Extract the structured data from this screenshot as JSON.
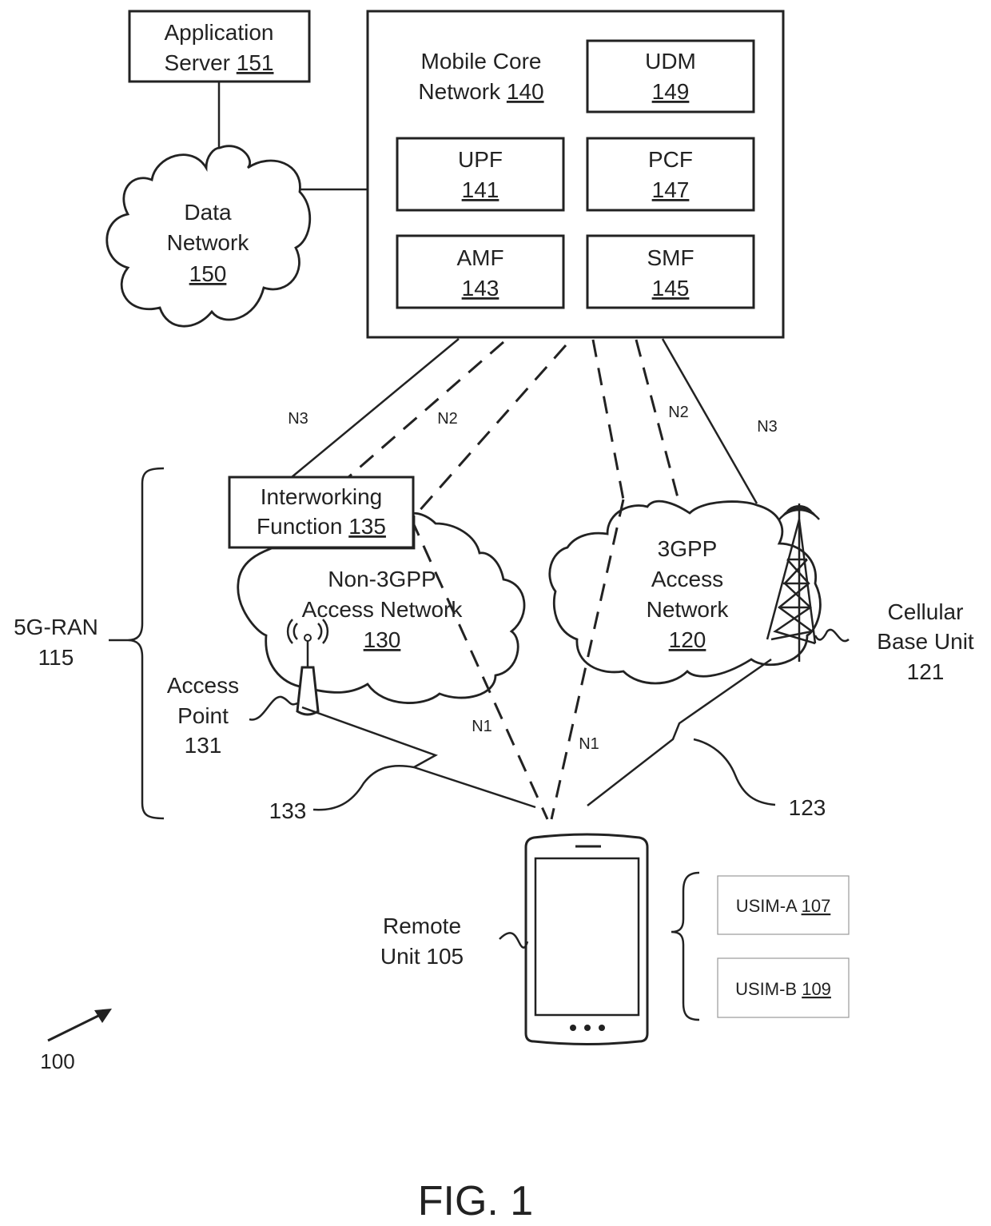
{
  "figure": {
    "title": "FIG. 1",
    "ref": "100"
  },
  "app_server": {
    "line1": "Application",
    "line2": "Server ",
    "num": "151"
  },
  "data_network": {
    "line1": "Data",
    "line2": "Network",
    "num": "150"
  },
  "core": {
    "line1": "Mobile Core",
    "line2": "Network ",
    "num": "140",
    "functions": [
      {
        "name": "UDM",
        "num": "149"
      },
      {
        "name": "UPF",
        "num": "141"
      },
      {
        "name": "PCF",
        "num": "147"
      },
      {
        "name": "AMF",
        "num": "143"
      },
      {
        "name": "SMF",
        "num": "145"
      }
    ]
  },
  "interfaces": {
    "n3_left": "N3",
    "n2_left": "N2",
    "n2_right": "N2",
    "n3_right": "N3",
    "n1_left": "N1",
    "n1_right": "N1"
  },
  "iwf": {
    "line1": "Interworking",
    "line2": "Function ",
    "num": "135"
  },
  "non3gpp": {
    "line1": "Non-3GPP",
    "line2": "Access Network",
    "num": "130"
  },
  "gpp": {
    "line1": "3GPP",
    "line2": "Access",
    "line3": "Network",
    "num": "120"
  },
  "ran": {
    "line1": "5G-RAN",
    "line2": "115"
  },
  "access_point": {
    "line1": "Access",
    "line2": "Point",
    "line3": "131"
  },
  "base_unit": {
    "line1": "Cellular",
    "line2": "Base Unit",
    "line3": "121"
  },
  "links": {
    "wlan": "133",
    "cell": "123"
  },
  "remote_unit": {
    "line1": "Remote",
    "line2": "Unit 105"
  },
  "usims": [
    {
      "label": "USIM-A ",
      "num": "107"
    },
    {
      "label": "USIM-B ",
      "num": "109"
    }
  ]
}
